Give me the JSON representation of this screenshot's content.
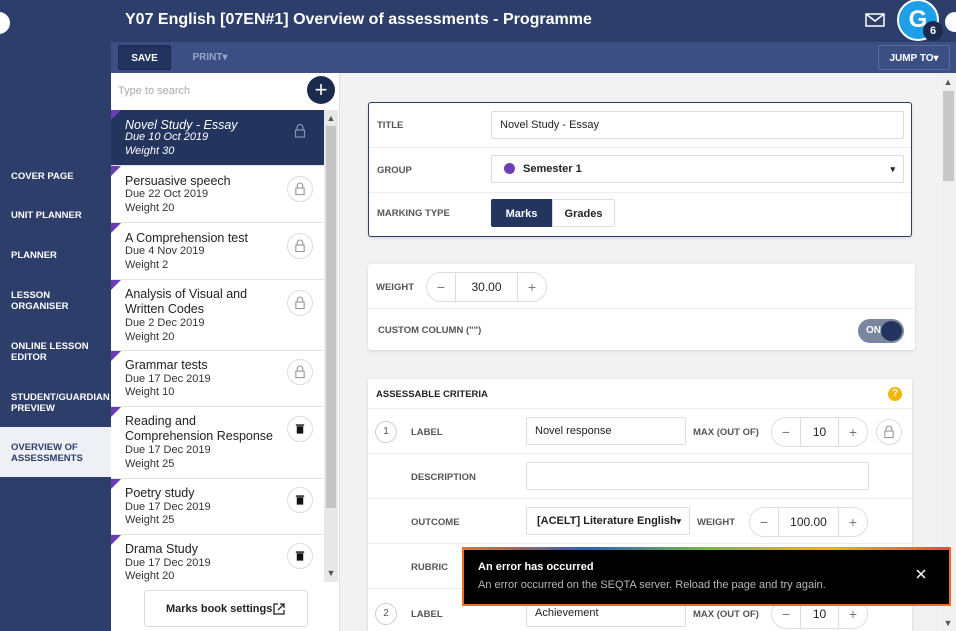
{
  "header": {
    "title": "Y07 English [07EN#1] Overview of assessments - Programme",
    "avatar_letter": "G",
    "avatar_badge": "6"
  },
  "toolbar": {
    "save_label": "SAVE",
    "print_label": "PRINT",
    "jump_label": "JUMP TO"
  },
  "nav": {
    "items": [
      {
        "label": "COVER PAGE"
      },
      {
        "label": "UNIT PLANNER"
      },
      {
        "label": "PLANNER"
      },
      {
        "label": "LESSON ORGANISER"
      },
      {
        "label": "ONLINE LESSON EDITOR"
      },
      {
        "label": "STUDENT/GUARDIAN PREVIEW"
      },
      {
        "label": "OVERVIEW OF ASSESSMENTS"
      }
    ]
  },
  "list": {
    "search_placeholder": "Type to search",
    "add_label": "+",
    "items": [
      {
        "title": "Novel Study - Essay",
        "due": "Due 10 Oct 2019",
        "weight": "Weight 30"
      },
      {
        "title": "Persuasive speech",
        "due": "Due 22 Oct 2019",
        "weight": "Weight 20"
      },
      {
        "title": "A Comprehension test",
        "due": "Due 4 Nov 2019",
        "weight": "Weight 2"
      },
      {
        "title": "Analysis of Visual and Written Codes",
        "due": "Due 2 Dec 2019",
        "weight": "Weight 20"
      },
      {
        "title": "Grammar tests",
        "due": "Due 17 Dec 2019",
        "weight": "Weight 10"
      },
      {
        "title": "Reading and Comprehension Response",
        "due": "Due 17 Dec 2019",
        "weight": "Weight 25"
      },
      {
        "title": "Poetry study",
        "due": "Due 17 Dec 2019",
        "weight": "Weight 25"
      },
      {
        "title": "Drama Study",
        "due": "Due 17 Dec 2019",
        "weight": "Weight 20"
      }
    ],
    "marks_settings_label": "Marks book settings"
  },
  "details": {
    "title_label": "TITLE",
    "title_value": "Novel Study - Essay",
    "group_label": "GROUP",
    "group_value": "Semester 1",
    "marking_label": "MARKING TYPE",
    "marking_options": [
      "Marks",
      "Grades"
    ]
  },
  "weight": {
    "label": "WEIGHT",
    "value": "30.00",
    "custom_label": "CUSTOM COLUMN (\"\")",
    "toggle_text": "ON"
  },
  "criteria": {
    "heading": "ASSESSABLE CRITERIA",
    "help": "?",
    "c1": {
      "num": "1",
      "label_label": "LABEL",
      "label_value": "Novel response",
      "max_label": "MAX (OUT OF)",
      "max_value": "10",
      "desc_label": "DESCRIPTION",
      "desc_value": "",
      "outcome_label": "OUTCOME",
      "outcome_value": "[ACELT] Literature English",
      "weight_label": "WEIGHT",
      "weight_value": "100.00",
      "rubric_label": "RUBRIC"
    },
    "c2": {
      "num": "2",
      "label_label": "LABEL",
      "label_value": "Achievement",
      "max_label": "MAX (OUT OF)",
      "max_value": "10"
    }
  },
  "toast": {
    "title": "An error has occurred",
    "message": "An error occurred on the SEQTA server. Reload the page and try again."
  },
  "colors": {
    "nav": "#2d3e6b",
    "toolbar": "#3b4f85",
    "accent": "#23345e",
    "purple": "#6a3fb5",
    "toast_border": "#f26d21"
  }
}
